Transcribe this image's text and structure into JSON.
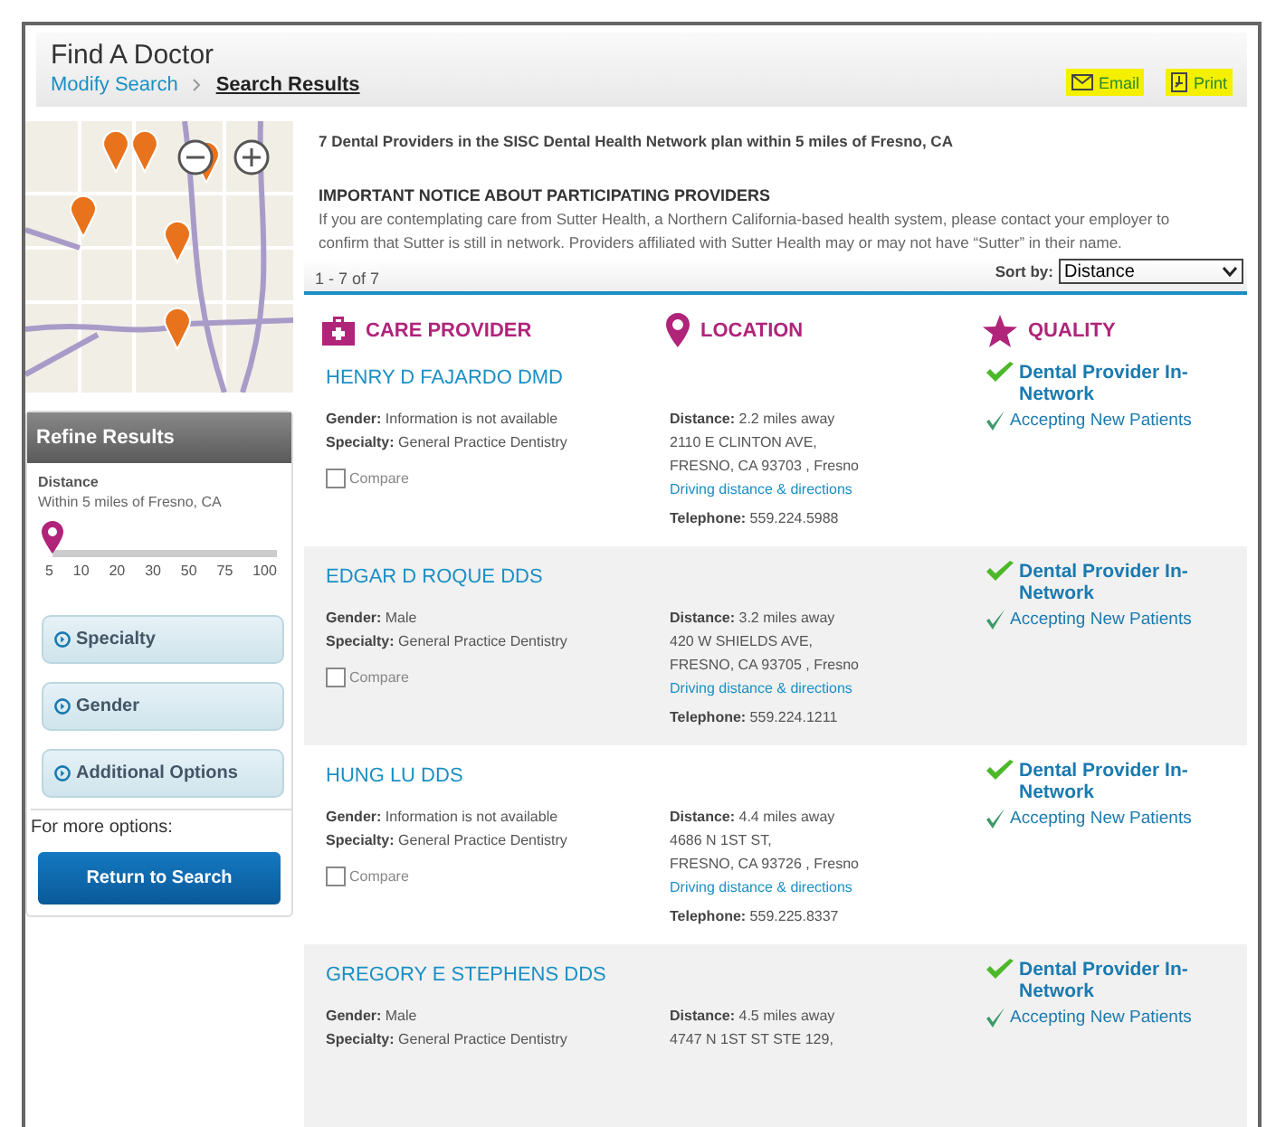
{
  "header": {
    "title": "Find A Doctor",
    "breadcrumb": [
      {
        "label": "Modify Search",
        "current": false
      },
      {
        "label": "Search Results",
        "current": true
      }
    ],
    "actions": [
      {
        "label": "Email",
        "kind": "email"
      },
      {
        "label": "Print",
        "kind": "print"
      }
    ]
  },
  "refine": {
    "title": "Refine Results",
    "distance_label": "Distance",
    "distance_value": "Within 5 miles of Fresno, CA",
    "slider": {
      "level": 0,
      "ticks": [
        "5",
        "10",
        "20",
        "30",
        "50",
        "75",
        "100"
      ]
    },
    "filters": [
      {
        "label": "Specialty",
        "expanded": false
      },
      {
        "label": "Gender",
        "expanded": false
      },
      {
        "label": "Additional Options",
        "expanded": false
      }
    ],
    "more_options": "For more options:",
    "return_button": "Return to Search"
  },
  "results": {
    "summary": "7 Dental Providers in the SISC Dental Health Network plan within 5 miles of Fresno, CA",
    "notice_title": "IMPORTANT NOTICE ABOUT PARTICIPATING PROVIDERS",
    "notice_text": "If you are contemplating care from Sutter Health, a Northern California-based health system, please contact your employer to confirm that Sutter is still in network. Providers affiliated with Sutter Health may or may not have “Sutter” in their name.",
    "count": "1 - 7 of 7",
    "sort_label": "Sort by:",
    "sort_value": "Distance",
    "columns": [
      {
        "label": "CARE PROVIDER",
        "kind": "provider"
      },
      {
        "label": "LOCATION",
        "kind": "location"
      },
      {
        "label": "QUALITY",
        "kind": "quality"
      }
    ],
    "providers": [
      {
        "name": "HENRY D FAJARDO DMD",
        "gender": "**Gender:** Information is not available",
        "specialty": "**Specialty:** General Practice Dentistry",
        "compare": {
          "label": "Compare",
          "checked": false
        },
        "distance": "**Distance:** 2.2 miles away",
        "address": [
          "2110 E CLINTON AVE,",
          "FRESNO, CA 93703 , Fresno"
        ],
        "directions": "Driving distance & directions",
        "telephone": "**Telephone:**  559.224.5988",
        "quality": [
          {
            "label": "Dental Provider In-Network",
            "kind": "network"
          },
          {
            "label": "Accepting New Patients",
            "kind": "accepting"
          }
        ]
      },
      {
        "name": "EDGAR D ROQUE DDS",
        "gender": "**Gender:** Male",
        "specialty": "**Specialty:** General Practice Dentistry",
        "compare": {
          "label": "Compare",
          "checked": false
        },
        "distance": "**Distance:** 3.2 miles away",
        "address": [
          "420 W SHIELDS AVE,",
          "FRESNO, CA 93705 , Fresno"
        ],
        "directions": "Driving distance & directions",
        "telephone": "**Telephone:**  559.224.1211",
        "quality": [
          {
            "label": "Dental Provider In-Network",
            "kind": "network"
          },
          {
            "label": "Accepting New Patients",
            "kind": "accepting"
          }
        ]
      },
      {
        "name": "HUNG LU DDS",
        "gender": "**Gender:** Information is not available",
        "specialty": "**Specialty:** General Practice Dentistry",
        "compare": {
          "label": "Compare",
          "checked": false
        },
        "distance": "**Distance:** 4.4 miles away",
        "address": [
          "4686 N 1ST ST,",
          "FRESNO, CA 93726 , Fresno"
        ],
        "directions": "Driving distance & directions",
        "telephone": "**Telephone:**  559.225.8337",
        "quality": [
          {
            "label": "Dental Provider In-Network",
            "kind": "network"
          },
          {
            "label": "Accepting New Patients",
            "kind": "accepting"
          }
        ]
      },
      {
        "name": "GREGORY E STEPHENS DDS",
        "gender": "**Gender:** Male",
        "specialty": "**Specialty:** General Practice Dentistry",
        "distance": "**Distance:** 4.5 miles away",
        "address": [
          "4747 N 1ST ST STE 129,"
        ],
        "quality": [
          {
            "label": "Dental Provider In-Network",
            "kind": "network"
          },
          {
            "label": "Accepting New Patients",
            "kind": "accepting"
          }
        ]
      }
    ]
  }
}
